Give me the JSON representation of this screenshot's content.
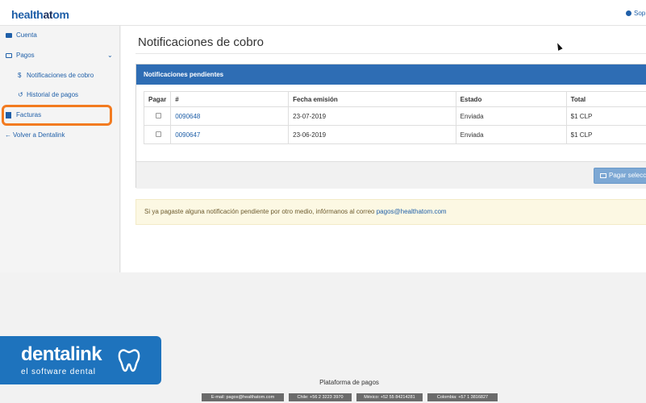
{
  "brand": {
    "part1": "health",
    "part2": "at",
    "part3": "om"
  },
  "header": {
    "user_label": "Sop"
  },
  "sidebar": {
    "items": [
      {
        "label": "Cuenta"
      },
      {
        "label": "Pagos"
      },
      {
        "label": "Notificaciones de cobro",
        "icon": "$"
      },
      {
        "label": "Historial de pagos"
      },
      {
        "label": "Facturas"
      },
      {
        "label": "Volver a Dentalink"
      }
    ]
  },
  "main": {
    "title": "Notificaciones de cobro",
    "panel": {
      "heading": "Notificaciones pendientes",
      "columns": [
        "Pagar",
        "#",
        "Fecha emisión",
        "Estado",
        "Total"
      ],
      "rows": [
        {
          "id": "0090648",
          "fecha": "23-07-2019",
          "estado": "Enviada",
          "total": "$1 CLP"
        },
        {
          "id": "0090647",
          "fecha": "23-06-2019",
          "estado": "Enviada",
          "total": "$1 CLP"
        }
      ],
      "pay_button": "Pagar selecc"
    },
    "alert": {
      "text": "Si ya pagaste alguna notificación pendiente por otro medio, infórmanos al correo ",
      "email": "pagos@healthatom.com"
    }
  },
  "dentalink": {
    "name": "dentalink",
    "tagline": "el software dental"
  },
  "footer": {
    "title": "Plataforma de pagos",
    "badges": [
      "E-mail: pagos@healthatom.com",
      "Chile: +56 2 3223 3970",
      "México: +52 55 84214281",
      "Colombia: +57 1 3816827"
    ]
  },
  "colors": {
    "primary": "#2e6db4",
    "link": "#1f5fa8",
    "highlight": "#f27b20",
    "alert_bg": "#fcf8e3",
    "dentalink_bg": "#1e73bd"
  }
}
